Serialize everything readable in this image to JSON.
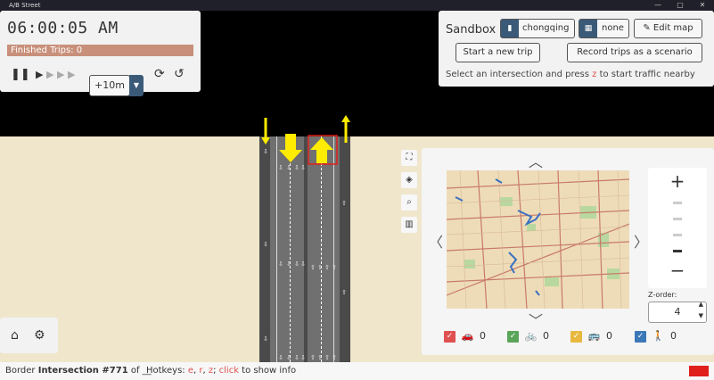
{
  "window": {
    "title": "A/B Street",
    "minimize": "—",
    "maximize": "▢",
    "close": "✕"
  },
  "time_panel": {
    "clock": "06:00:05 AM",
    "finished_trips": "Finished Trips: 0",
    "speed_value": "+10m"
  },
  "sandbox": {
    "title": "Sandbox",
    "map_name": "chongqing",
    "scenario": "none",
    "edit_map": "Edit map",
    "new_trip": "Start a new trip",
    "record_trips": "Record trips as a scenario",
    "hint_prefix": "Select an intersection and press ",
    "hint_key": "z",
    "hint_suffix": " to start traffic nearby"
  },
  "minimap": {
    "zorder_label": "Z-order:",
    "zorder_value": "4",
    "filters": [
      {
        "color": "#e05050",
        "icon": "car-icon",
        "count": "0"
      },
      {
        "color": "#5aa55a",
        "icon": "bike-icon",
        "count": "0"
      },
      {
        "color": "#e8b840",
        "icon": "bus-icon",
        "count": "0"
      },
      {
        "color": "#3b78b8",
        "icon": "pedestrian-icon",
        "count": "0"
      }
    ]
  },
  "status": {
    "prefix": "Border ",
    "intersection": "Intersection #771",
    "of_text": " of __",
    "hotkeys_label": "Hotkeys: ",
    "key_e": "e",
    "sep1": ", ",
    "key_r": "r",
    "sep2": ", ",
    "key_z": "z",
    "sep3": "; ",
    "click": "click",
    "click_suffix": " to show info"
  },
  "colors": {
    "accent": "#3b5a78",
    "trips_bar": "#c8907a",
    "hotkey": "#e05050",
    "map_bg": "#f0e6cc"
  }
}
